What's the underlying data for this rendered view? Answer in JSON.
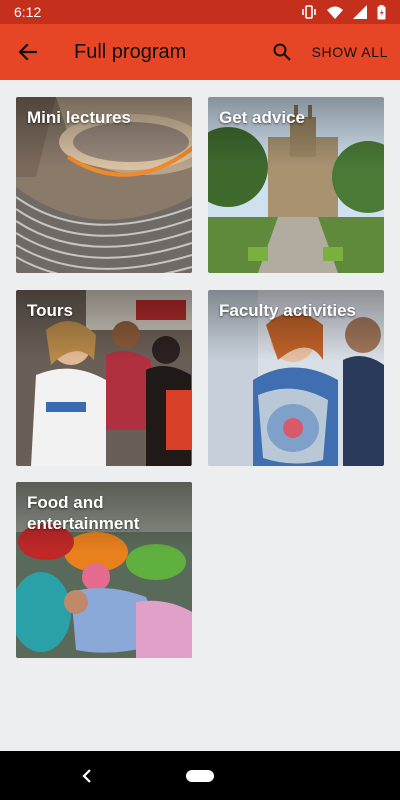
{
  "status_bar": {
    "time": "6:12",
    "icons": [
      "vibrate-icon",
      "wifi-icon",
      "signal-icon",
      "battery-icon"
    ]
  },
  "app_bar": {
    "title": "Full program",
    "show_all_label": "SHOW ALL",
    "back_icon": "arrow-back-icon",
    "search_icon": "search-icon"
  },
  "tiles": [
    {
      "label": "Mini lectures"
    },
    {
      "label": "Get advice"
    },
    {
      "label": "Tours"
    },
    {
      "label": "Faculty activities"
    },
    {
      "label": "Food and entertainment"
    }
  ],
  "colors": {
    "status_bar": "#c4301c",
    "app_bar": "#e64626",
    "background": "#eceeef"
  }
}
